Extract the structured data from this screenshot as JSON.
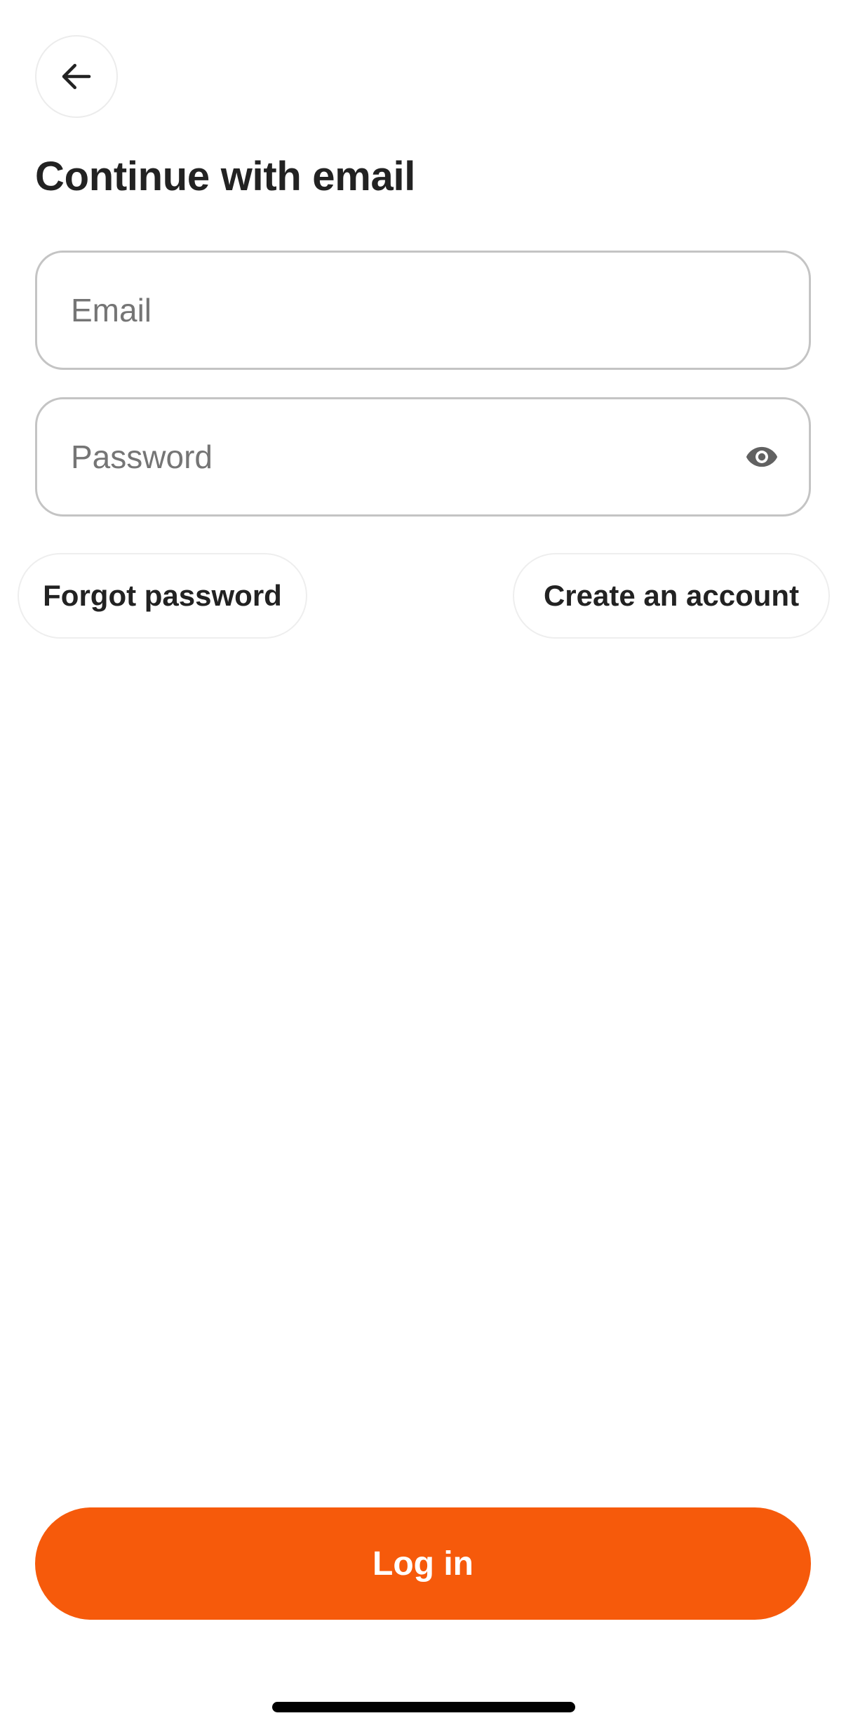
{
  "header": {
    "back_icon": "arrow-left-icon",
    "title": "Continue with email"
  },
  "form": {
    "email_placeholder": "Email",
    "email_value": "",
    "password_placeholder": "Password",
    "password_value": "",
    "password_toggle_icon": "eye-icon"
  },
  "links": {
    "forgot_password": "Forgot password",
    "create_account": "Create an account"
  },
  "actions": {
    "login_label": "Log in"
  },
  "colors": {
    "accent": "#f65a0b",
    "text": "#222222",
    "placeholder": "#757575",
    "border": "#c4c4c4"
  }
}
